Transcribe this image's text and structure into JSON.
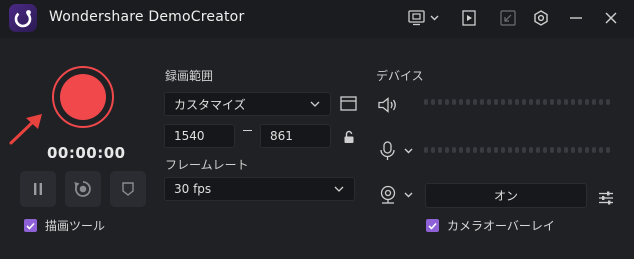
{
  "app": {
    "title": "Wondershare DemoCreator"
  },
  "titlebar": {
    "icons": [
      "screen-settings-icon",
      "chevron-down-icon",
      "play-panel-icon",
      "shrink-icon",
      "gear-icon",
      "minimize-icon",
      "close-icon"
    ]
  },
  "recorder": {
    "timer": "00:00:00",
    "record_button_color": "#f0484b"
  },
  "capture_area": {
    "label": "録画範囲",
    "mode": "カスタマイズ",
    "width": "1540",
    "height": "861",
    "separator": "–"
  },
  "frame_rate": {
    "label": "フレームレート",
    "value": "30 fps"
  },
  "devices": {
    "label": "デバイス",
    "webcam_toggle": "オン",
    "camera_overlay_label": "カメラオーバーレイ"
  },
  "drawing_tools": {
    "label": "描画ツール"
  },
  "colors": {
    "accent": "#8f61d6",
    "record": "#f0484b",
    "background": "#202125"
  }
}
